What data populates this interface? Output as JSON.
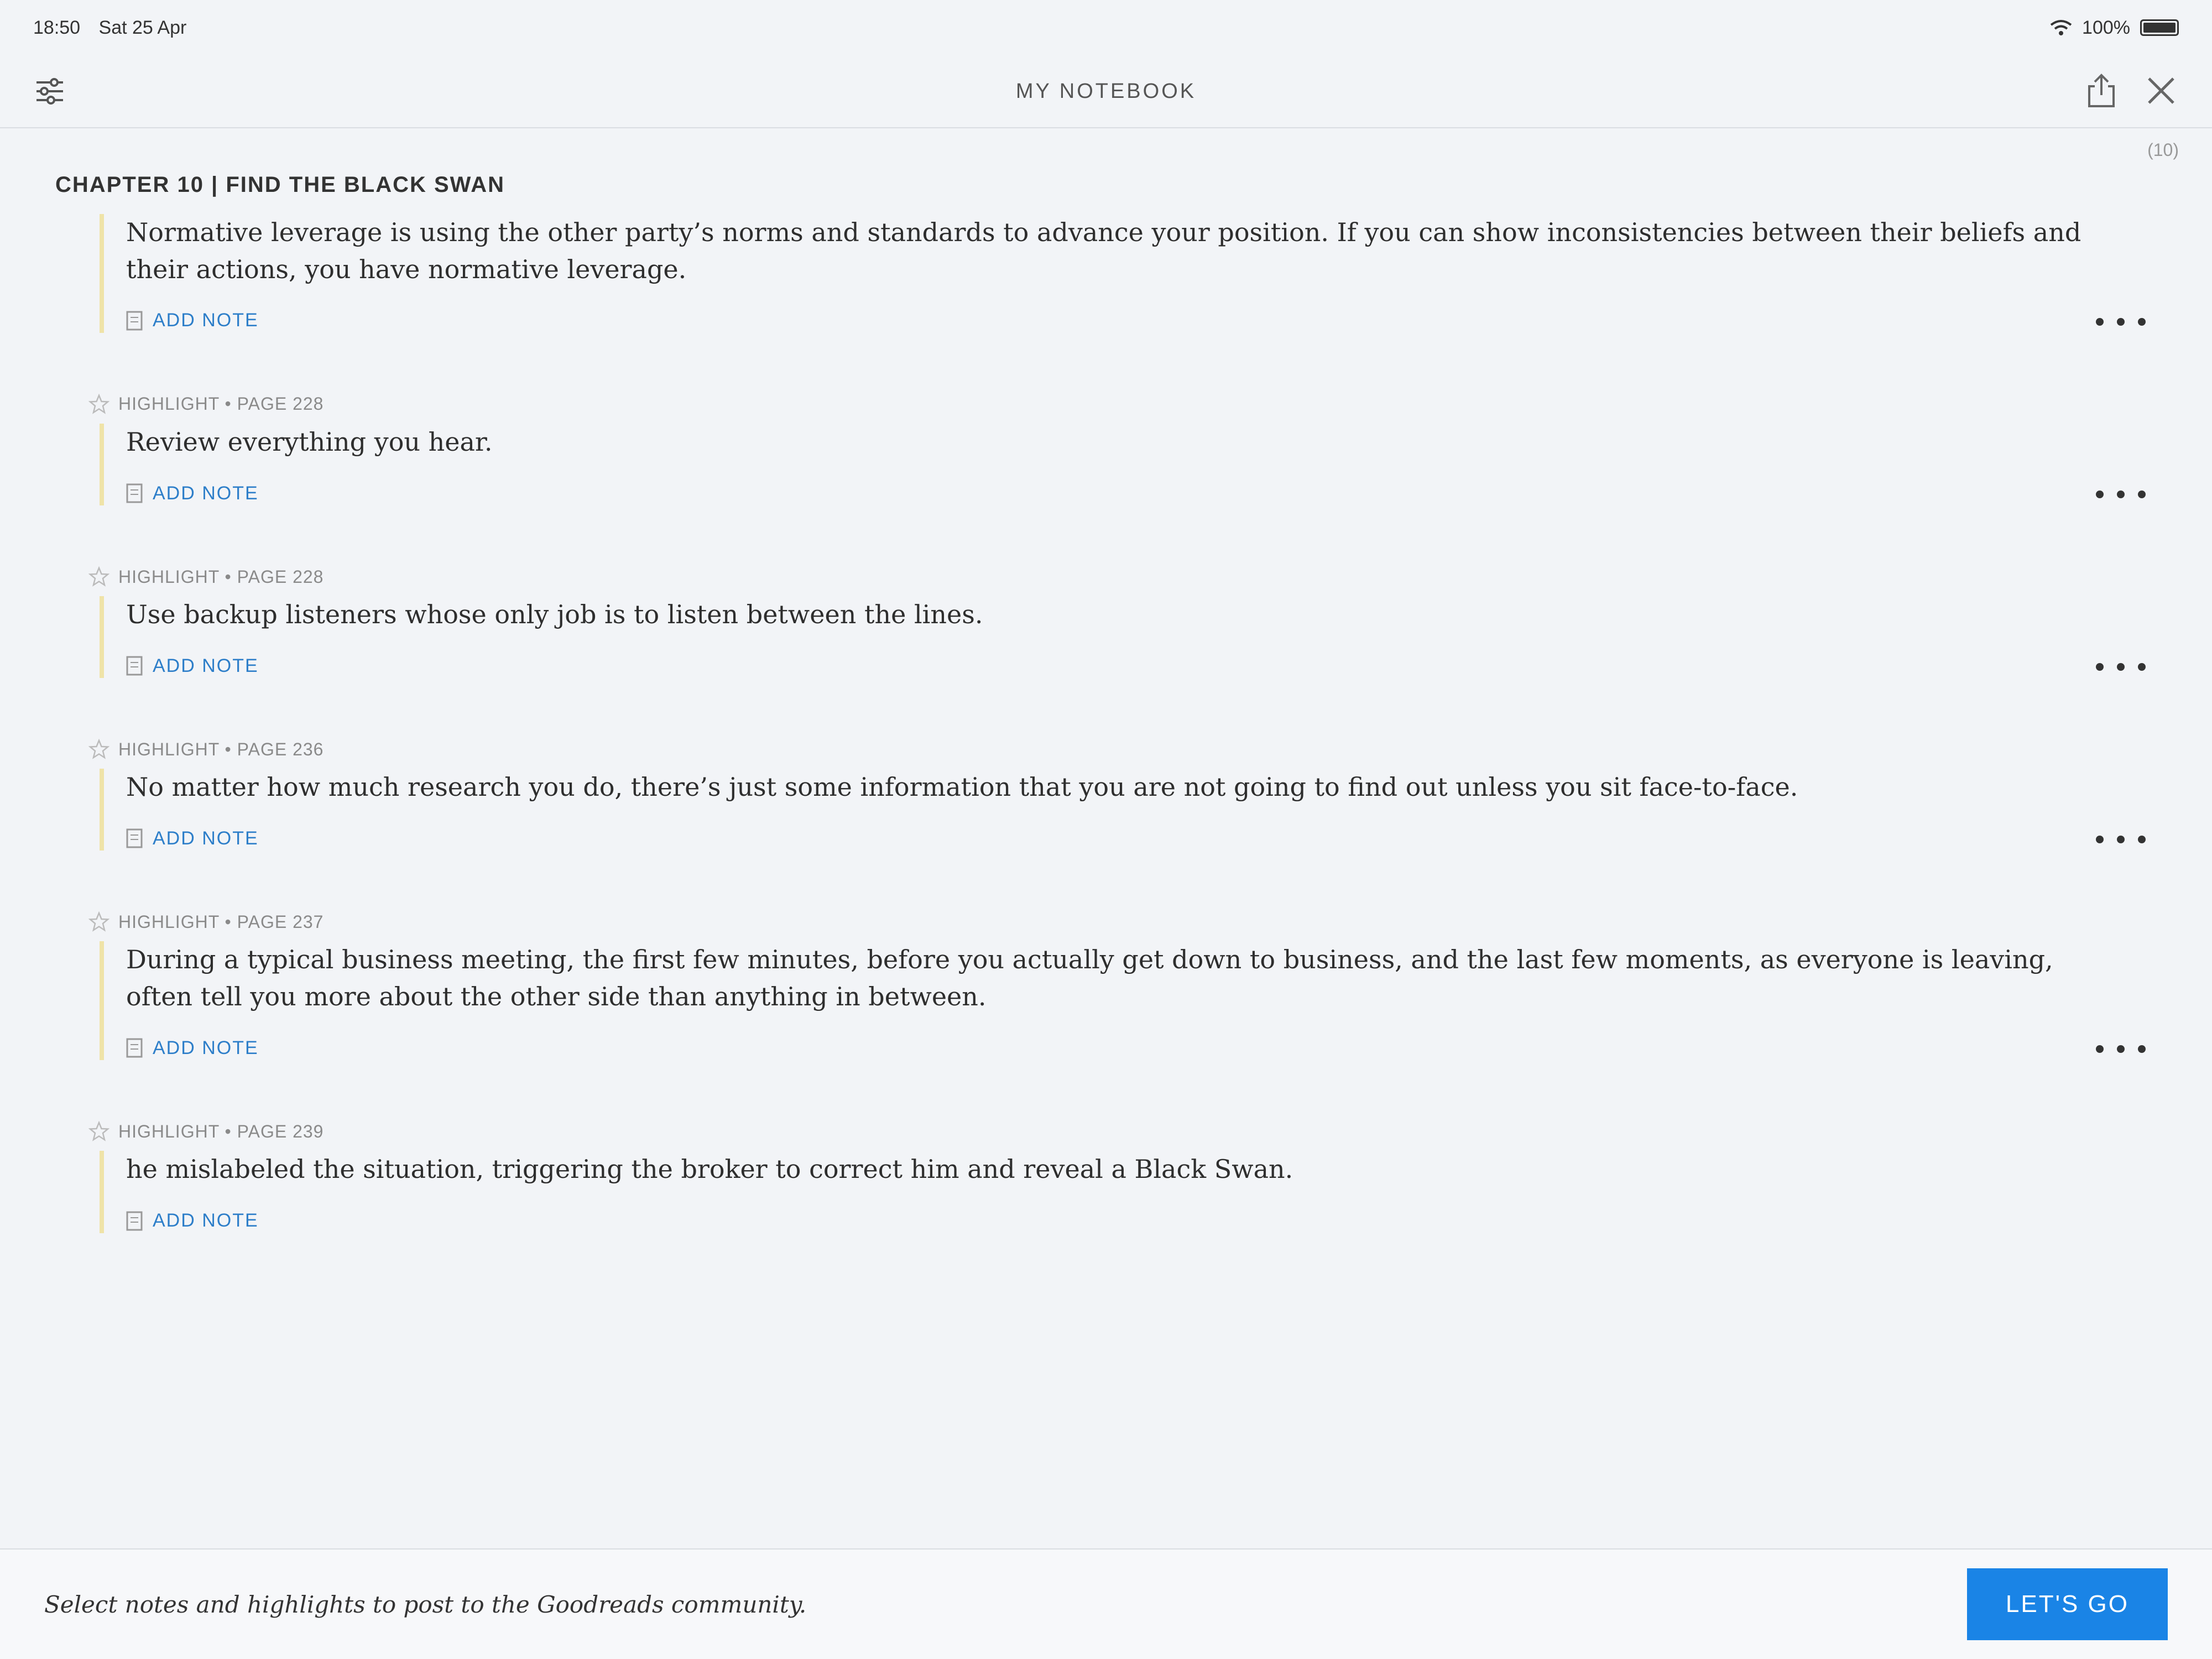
{
  "status_bar": {
    "time": "18:50",
    "date": "Sat 25 Apr",
    "battery": "100%"
  },
  "header": {
    "title": "MY NOTEBOOK",
    "count": "(10)"
  },
  "chapter": {
    "title": "CHAPTER 10 | FIND THE BLACK SWAN"
  },
  "entries": [
    {
      "meta": "",
      "text": "Normative leverage is using the other party’s norms and standards to advance your position. If you can show inconsistencies between their beliefs and their actions, you have normative leverage.",
      "add_note": "ADD NOTE"
    },
    {
      "meta": "HIGHLIGHT • PAGE 228",
      "text": "Review everything you hear.",
      "add_note": "ADD NOTE"
    },
    {
      "meta": "HIGHLIGHT • PAGE 228",
      "text": "Use backup listeners whose only job is to listen between the lines.",
      "add_note": "ADD NOTE"
    },
    {
      "meta": "HIGHLIGHT • PAGE 236",
      "text": "No matter how much research you do, there’s just some information that you are not going to find out unless you sit face-to-face.",
      "add_note": "ADD NOTE"
    },
    {
      "meta": "HIGHLIGHT • PAGE 237",
      "text": "During a typical business meeting, the first few minutes, before you actually get down to business, and the last few moments, as everyone is leaving, often tell you more about the other side than anything in between.",
      "add_note": "ADD NOTE"
    },
    {
      "meta": "HIGHLIGHT • PAGE 239",
      "text": "he mislabeled the situation, triggering the broker to correct him and reveal a Black Swan.",
      "add_note": "ADD NOTE"
    }
  ],
  "footer": {
    "prompt": "Select notes and highlights to post to the Goodreads community.",
    "button_label": "LET'S GO"
  },
  "colors": {
    "accent": "#1a84e6",
    "link": "#2d7ec9",
    "highlight_bar": "#efe3a8"
  },
  "icons": [
    "filter-icon",
    "share-icon",
    "close-icon",
    "star-icon",
    "note-icon",
    "more-icon",
    "wifi-icon",
    "battery-icon"
  ]
}
